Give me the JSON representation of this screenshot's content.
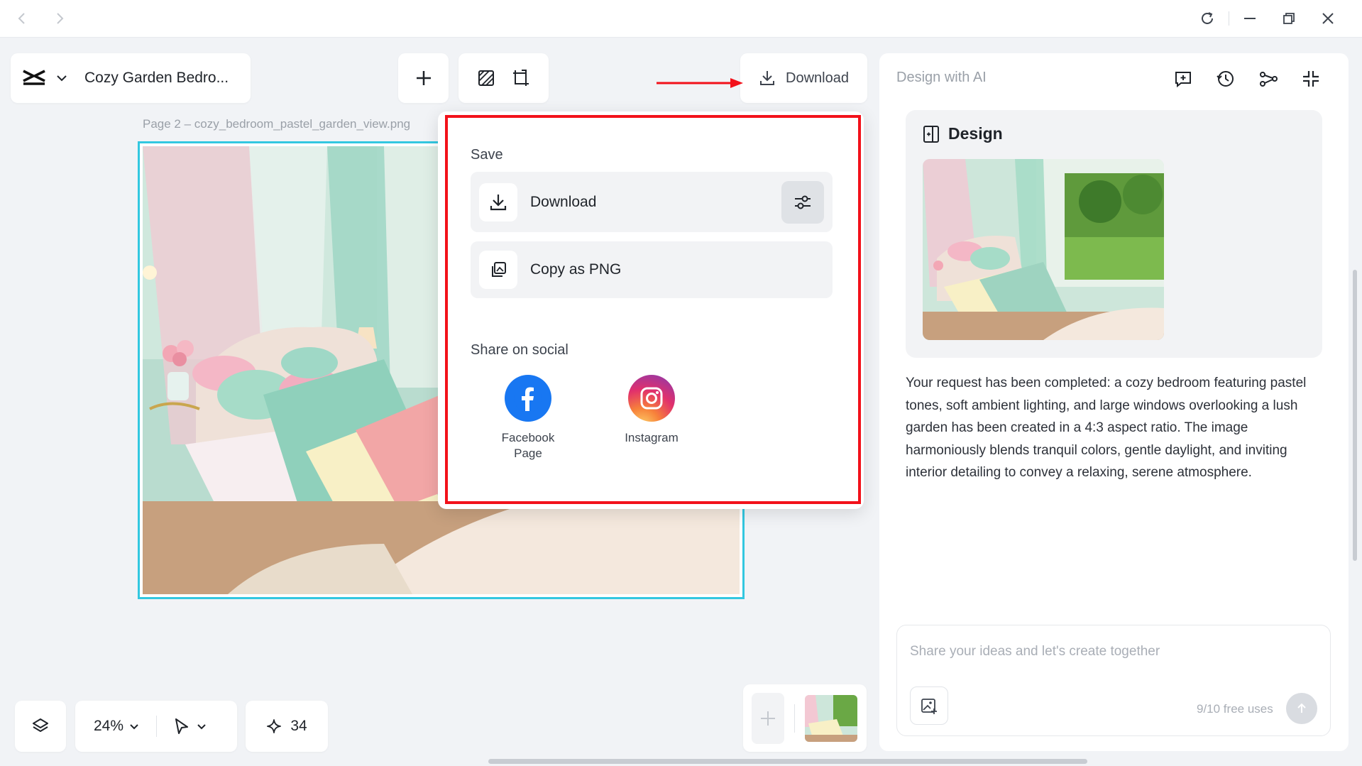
{
  "browser": {
    "back_icon": "chevron-left-icon",
    "forward_icon": "chevron-right-icon",
    "reload_icon": "reload-icon",
    "minimize_icon": "minimize-icon",
    "restore_icon": "restore-icon",
    "close_icon": "close-icon"
  },
  "header": {
    "doc_title": "Cozy Garden Bedro...",
    "download_label": "Download"
  },
  "canvas": {
    "page_label": "Page 2 –  cozy_bedroom_pastel_garden_view.png",
    "selection_color": "#33c7e0"
  },
  "download_menu": {
    "save_heading": "Save",
    "download_label": "Download",
    "copy_label": "Copy as PNG",
    "share_heading": "Share on social",
    "social": [
      {
        "name": "Facebook\nPage",
        "color": "#1877f2"
      },
      {
        "name": "Instagram",
        "color": "#e1306c"
      }
    ],
    "highlight_color": "#f2111a"
  },
  "ai_panel": {
    "title": "Design with AI",
    "card_heading": "Design",
    "description": "Your request has been completed: a cozy bedroom featuring pastel tones, soft ambient lighting, and large windows overlooking a lush garden has been created in a 4:3 aspect ratio. The image harmoniously blends tranquil colors, gentle daylight, and inviting interior detailing to convey a relaxing, serene atmosphere.",
    "chat_placeholder": "Share your ideas and let's create together",
    "free_uses": "9/10 free uses"
  },
  "bottom_bar": {
    "zoom": "24%",
    "credits": "34"
  }
}
